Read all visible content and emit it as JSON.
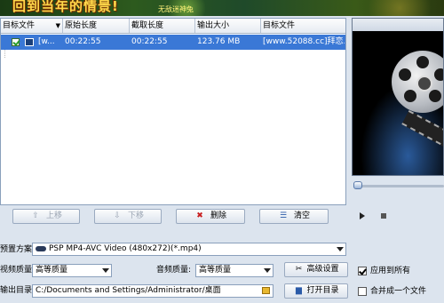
{
  "banner": {
    "title": "回到当年的情景!",
    "small_text": "无敌迷神兔"
  },
  "table": {
    "columns": [
      "目标文件",
      "原始长度",
      "截取长度",
      "输出大小",
      "目标文件"
    ],
    "rows": [
      {
        "source": "[w...",
        "original_length": "00:22:55",
        "cut_length": "00:22:55",
        "output_size": "123.76 MB",
        "target_file": "[www.52088.cc]拜恋..."
      }
    ]
  },
  "buttons": {
    "move_up": "上移",
    "move_down": "下移",
    "delete": "删除",
    "clear": "清空"
  },
  "settings": {
    "preset_label": "预置方案:",
    "preset_value": "PSP MP4-AVC Video (480x272)(*.mp4)",
    "video_quality_label": "视频质量:",
    "video_quality_value": "高等质量",
    "audio_quality_label": "音频质量:",
    "audio_quality_value": "高等质量",
    "advanced_button": "高级设置",
    "apply_all_label": "应用到所有",
    "output_dir_label": "输出目录:",
    "output_dir_value": "C:/Documents and Settings/Administrator/桌面",
    "open_dir_button": "打开目录",
    "merge_label": "合并成一个文件"
  },
  "icons": {
    "delete": "x-icon",
    "clear": "clear-list-icon",
    "advanced": "scissors-icon",
    "open_dir": "folder-icon",
    "play": "play-icon",
    "stop": "stop-icon"
  },
  "colors": {
    "selection": "#3a78d6",
    "banner_text": "#ffd84a",
    "background": "#dce4ee"
  }
}
